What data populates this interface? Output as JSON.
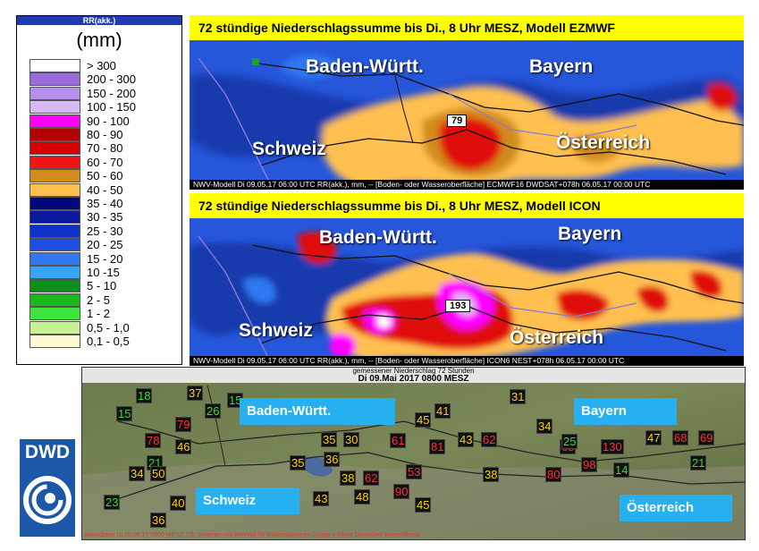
{
  "legend": {
    "header": "RR(akk.)",
    "unit": "(mm)",
    "items": [
      {
        "label": "> 300",
        "color": "#ffffff"
      },
      {
        "label": "200 - 300",
        "color": "#9b6bdc"
      },
      {
        "label": "150 - 200",
        "color": "#b490ea"
      },
      {
        "label": "100 - 150",
        "color": "#d7b9f4"
      },
      {
        "label": "90 - 100",
        "color": "#ff00ff"
      },
      {
        "label": "80 - 90",
        "color": "#b40000"
      },
      {
        "label": "70 - 80",
        "color": "#d80000"
      },
      {
        "label": "60 - 70",
        "color": "#f01414"
      },
      {
        "label": "50 - 60",
        "color": "#d28c1e"
      },
      {
        "label": "40 - 50",
        "color": "#ffc050"
      },
      {
        "label": "35 - 40",
        "color": "#00087a"
      },
      {
        "label": "30 - 35",
        "color": "#0a1aa0"
      },
      {
        "label": "25 - 30",
        "color": "#1030c8"
      },
      {
        "label": "20 - 25",
        "color": "#1e4ee6"
      },
      {
        "label": "15 - 20",
        "color": "#2f78f2"
      },
      {
        "label": "10 -15",
        "color": "#37a4f5"
      },
      {
        "label": "5 - 10",
        "color": "#0f8c1e"
      },
      {
        "label": "2 - 5",
        "color": "#19b91e"
      },
      {
        "label": "1 - 2",
        "color": "#3ce63c"
      },
      {
        "label": "0,5 - 1,0",
        "color": "#c8f096"
      },
      {
        "label": "0,1 - 0,5",
        "color": "#fffad2"
      }
    ]
  },
  "ezmwf": {
    "title": "72 stündige Niederschlagssumme bis Di., 8 Uhr MESZ, Modell EZMWF",
    "regions": {
      "bw": "Baden-Württ.",
      "bayern": "Bayern",
      "schweiz": "Schweiz",
      "oesterreich": "Österreich"
    },
    "max_value": "79",
    "footer": "NWV-Modell  Di 09.05.17 06:00 UTC  RR(akk.), mm, -- [Boden- oder Wasseroberfläche] ECMWF16 DWDSAT+078h 06.05.17 00:00 UTC"
  },
  "icon": {
    "title": "72 stündige Niederschlagssumme bis Di., 8 Uhr MESZ, Modell ICON",
    "regions": {
      "bw": "Baden-Württ.",
      "bayern": "Bayern",
      "schweiz": "Schweiz",
      "oesterreich": "Österreich"
    },
    "max_value": "193",
    "footer": "NWV-Modell  Di 09.05.17 06:00 UTC  RR(akk.), mm, -- [Boden- oder Wasseroberfläche] ICON6  NEST+078h 06.05.17 00:00 UTC"
  },
  "observed": {
    "subtitle": "gemessener Niederschlag 72 Stunden",
    "title": "Di 09.Mai 2017 0800 MESZ",
    "regions": {
      "bw": "Baden-Württ.",
      "bayern": "Bayern",
      "schweiz": "Schweiz",
      "oesterreich": "Österreich"
    },
    "footer": "Basisdaten Di 09.05.17 0800 MESZ  72h Summen mit Intervall für Bodenstationen  Synop + Klima  Deutscher Wetterdienst",
    "stations": [
      {
        "v": "37",
        "c": "#ffd000"
      },
      {
        "v": "18",
        "c": "#33dd33"
      },
      {
        "v": "15",
        "c": "#33dd33"
      },
      {
        "v": "26",
        "c": "#33dd33"
      },
      {
        "v": "15",
        "c": "#33dd33"
      },
      {
        "v": "79",
        "c": "#ff3030"
      },
      {
        "v": "78",
        "c": "#ff3030"
      },
      {
        "v": "46",
        "c": "#ffd000"
      },
      {
        "v": "21",
        "c": "#33dd33"
      },
      {
        "v": "34",
        "c": "#ffd000"
      },
      {
        "v": "50",
        "c": "#ffd000"
      },
      {
        "v": "23",
        "c": "#33dd33"
      },
      {
        "v": "40",
        "c": "#ffd000"
      },
      {
        "v": "36",
        "c": "#ffd000"
      },
      {
        "v": "35",
        "c": "#ffd000"
      },
      {
        "v": "36",
        "c": "#ffd000"
      },
      {
        "v": "35",
        "c": "#ffd000"
      },
      {
        "v": "30",
        "c": "#ffd000"
      },
      {
        "v": "43",
        "c": "#ffd000"
      },
      {
        "v": "48",
        "c": "#ffd000"
      },
      {
        "v": "61",
        "c": "#ff3030"
      },
      {
        "v": "45",
        "c": "#ffd000"
      },
      {
        "v": "41",
        "c": "#ffd000"
      },
      {
        "v": "43",
        "c": "#ffd000"
      },
      {
        "v": "62",
        "c": "#ff3030"
      },
      {
        "v": "81",
        "c": "#ff3030"
      },
      {
        "v": "53",
        "c": "#ff3030"
      },
      {
        "v": "90",
        "c": "#ff3030"
      },
      {
        "v": "31",
        "c": "#ffd000"
      },
      {
        "v": "45",
        "c": "#ffd000"
      },
      {
        "v": "38",
        "c": "#ffd000"
      },
      {
        "v": "34",
        "c": "#ffd000"
      },
      {
        "v": "68",
        "c": "#ff3030"
      },
      {
        "v": "130",
        "c": "#ff3030"
      },
      {
        "v": "98",
        "c": "#ff3030"
      },
      {
        "v": "47",
        "c": "#ffd000"
      },
      {
        "v": "68",
        "c": "#ff3030"
      },
      {
        "v": "69",
        "c": "#ff3030"
      },
      {
        "v": "25",
        "c": "#33dd33"
      },
      {
        "v": "21",
        "c": "#33dd33"
      },
      {
        "v": "14",
        "c": "#33dd33"
      },
      {
        "v": "80",
        "c": "#ff3030"
      },
      {
        "v": "62",
        "c": "#ff3030"
      },
      {
        "v": "38",
        "c": "#ffd000"
      }
    ]
  }
}
